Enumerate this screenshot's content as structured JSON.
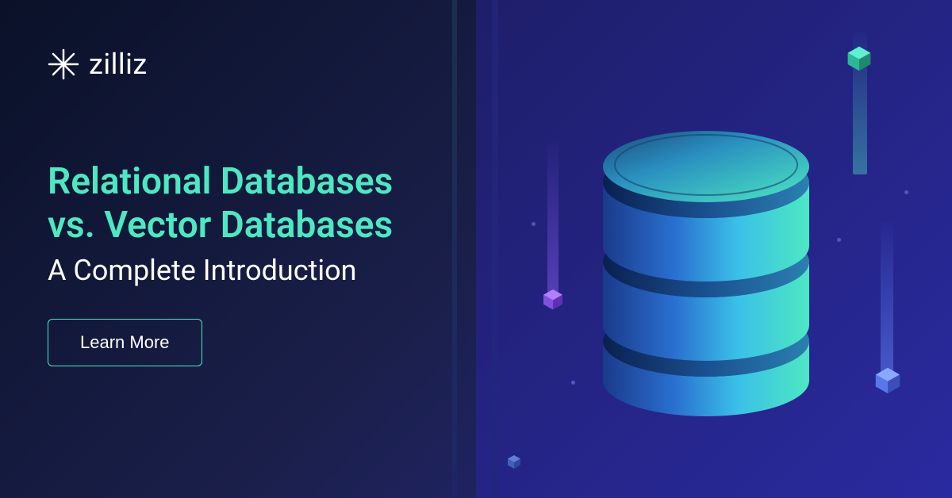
{
  "brand": {
    "name": "zilliz"
  },
  "hero": {
    "headline_line1": "Relational Databases",
    "headline_line2": "vs. Vector Databases",
    "subheadline": "A Complete Introduction",
    "cta_label": "Learn More"
  },
  "colors": {
    "accent": "#4de8c2",
    "background_start": "#0a1128",
    "background_end": "#2a2a8a"
  }
}
